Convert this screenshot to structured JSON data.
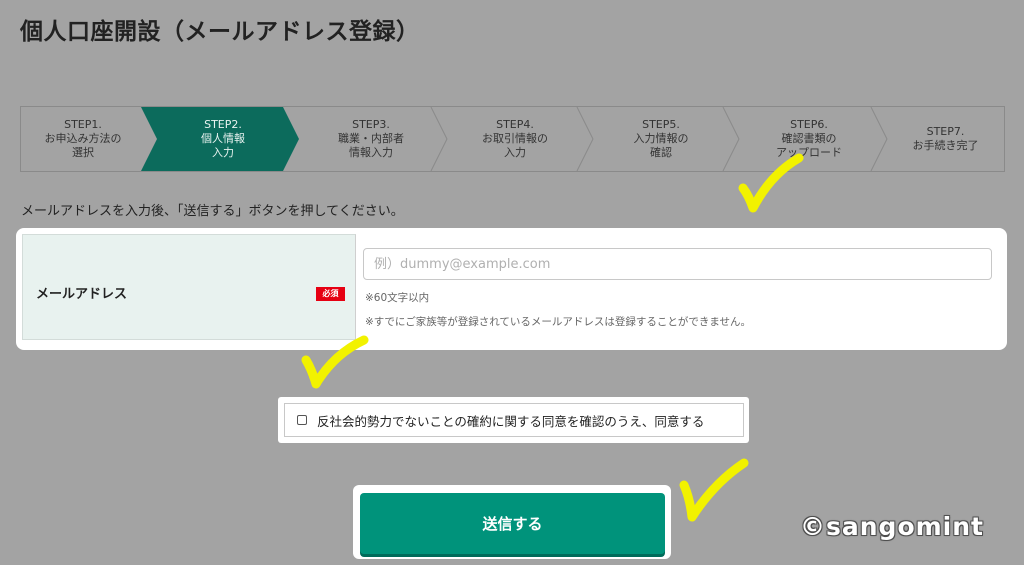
{
  "page": {
    "title": "個人口座開設（メールアドレス登録）",
    "instruction": "メールアドレスを入力後、「送信する」ボタンを押してください。"
  },
  "stepper": {
    "active_index": 1,
    "steps": [
      {
        "line1": "STEP1.",
        "line2": "お申込み方法の",
        "line3": "選択"
      },
      {
        "line1": "STEP2.",
        "line2": "個人情報",
        "line3": "入力"
      },
      {
        "line1": "STEP3.",
        "line2": "職業・内部者",
        "line3": "情報入力"
      },
      {
        "line1": "STEP4.",
        "line2": "お取引情報の",
        "line3": "入力"
      },
      {
        "line1": "STEP5.",
        "line2": "入力情報の",
        "line3": "確認"
      },
      {
        "line1": "STEP6.",
        "line2": "確認書類の",
        "line3": "アップロード"
      },
      {
        "line1": "STEP7.",
        "line2": "お手続き完了",
        "line3": ""
      }
    ]
  },
  "form": {
    "email_label": "メールアドレス",
    "required_badge": "必須",
    "email_placeholder": "例）dummy@example.com",
    "email_value": "",
    "note_length": "※60文字以内",
    "note_family": "※すでにご家族等が登録されているメールアドレスは登録することができません。"
  },
  "agreement": {
    "checked": false,
    "label": "反社会的勢力でないことの確約に関する同意を確認のうえ、同意する"
  },
  "submit": {
    "label": "送信する"
  },
  "watermark": "©sangomint",
  "colors": {
    "background": "#a3a3a3",
    "brand_green": "#00937b",
    "active_step": "#0c6b5c",
    "required_red": "#e60012",
    "annotation_yellow": "#f2f200"
  },
  "icons": [
    "yellow-checkmark-annotation-icon"
  ]
}
